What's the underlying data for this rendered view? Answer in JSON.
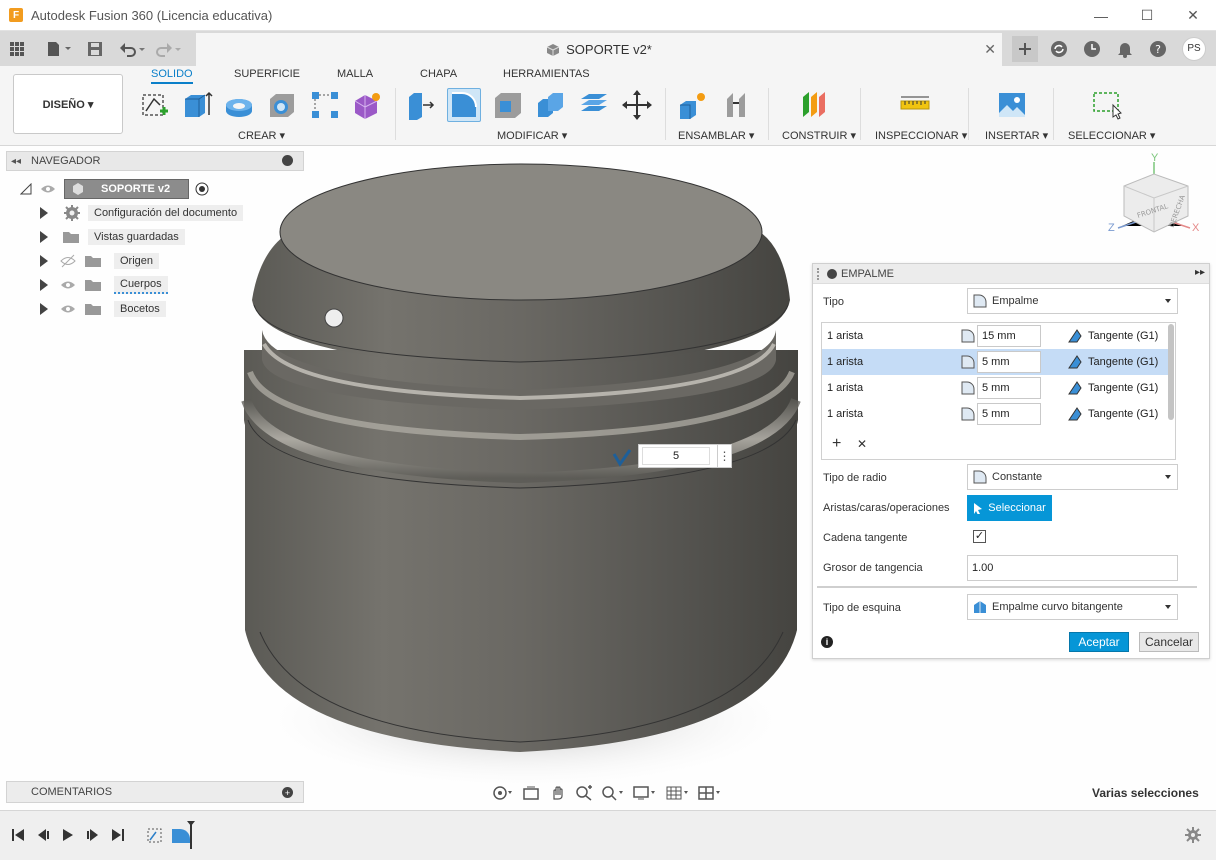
{
  "window": {
    "title": "Autodesk Fusion 360 (Licencia educativa)",
    "minimize": "—",
    "maximize": "☐",
    "close": "✕"
  },
  "doc_tab": {
    "title": "SOPORTE v2*",
    "close": "✕"
  },
  "user": {
    "initials": "PS"
  },
  "ribbon": {
    "workspace": "DISEÑO ▾",
    "tabs": [
      "SOLIDO",
      "SUPERFICIE",
      "MALLA",
      "CHAPA",
      "HERRAMIENTAS"
    ],
    "groups": [
      "CREAR ▾",
      "MODIFICAR ▾",
      "ENSAMBLAR ▾",
      "CONSTRUIR ▾",
      "INSPECCIONAR ▾",
      "INSERTAR ▾",
      "SELECCIONAR ▾"
    ]
  },
  "navigator": {
    "header": "NAVEGADOR",
    "root": "SOPORTE v2",
    "items": [
      "Configuración del documento",
      "Vistas guardadas",
      "Origen",
      "Cuerpos",
      "Bocetos"
    ]
  },
  "viewcube": {
    "front": "FRONTAL",
    "right": "DERECHA",
    "x": "X",
    "y": "Y",
    "z": "Z"
  },
  "dimension_input": {
    "value": "5"
  },
  "panel": {
    "title": "EMPALME",
    "tipo_label": "Tipo",
    "tipo_value": "Empalme",
    "edges": [
      {
        "count": "1 arista",
        "radius": "15 mm",
        "continuity": "Tangente (G1)"
      },
      {
        "count": "1 arista",
        "radius": "5 mm",
        "continuity": "Tangente (G1)"
      },
      {
        "count": "1 arista",
        "radius": "5 mm",
        "continuity": "Tangente (G1)"
      },
      {
        "count": "1 arista",
        "radius": "5 mm",
        "continuity": "Tangente (G1)"
      }
    ],
    "add": "+",
    "remove": "✕",
    "radio_label": "Tipo de radio",
    "radio_value": "Constante",
    "select_label": "Aristas/caras/operaciones",
    "select_btn": "Seleccionar",
    "chain_label": "Cadena tangente",
    "chain_checked": "✓",
    "weight_label": "Grosor de tangencia",
    "weight_value": "1.00",
    "corner_label": "Tipo de esquina",
    "corner_value": "Empalme curvo bitangente",
    "ok": "Aceptar",
    "cancel": "Cancelar"
  },
  "comments": {
    "label": "COMENTARIOS"
  },
  "status": {
    "text": "Varias selecciones"
  }
}
